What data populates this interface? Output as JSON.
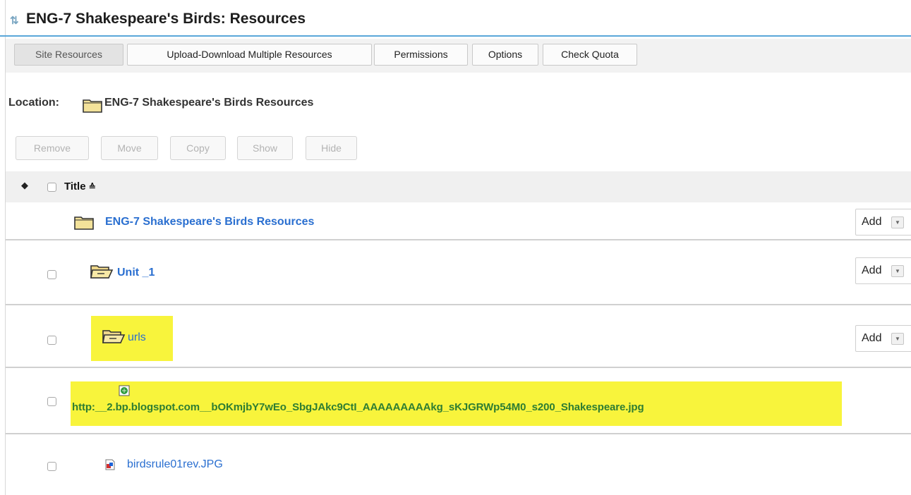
{
  "header": {
    "title": "ENG-7 Shakespeare's Birds: Resources",
    "sync_icon": "sync-arrows-icon"
  },
  "tabs": [
    {
      "label": "Site Resources",
      "active": true
    },
    {
      "label": "Upload-Download Multiple Resources",
      "active": false
    },
    {
      "label": "Permissions",
      "active": false
    },
    {
      "label": "Options",
      "active": false
    },
    {
      "label": "Check Quota",
      "active": false
    }
  ],
  "location": {
    "label": "Location:",
    "path": "ENG-7 Shakespeare's Birds Resources",
    "icon": "folder-icon"
  },
  "actions": [
    "Remove",
    "Move",
    "Copy",
    "Show",
    "Hide"
  ],
  "table": {
    "title_header": "Title"
  },
  "rows": [
    {
      "name": "ENG-7 Shakespeare's Birds Resources",
      "type": "folder",
      "has_checkbox": false,
      "action": "Add"
    },
    {
      "name": "Unit _1",
      "type": "folder-open",
      "has_checkbox": true,
      "action": "Add"
    },
    {
      "name": "urls",
      "type": "folder-open",
      "has_checkbox": true,
      "action": "Add",
      "highlighted": true
    },
    {
      "name": "http:__2.bp.blogspot.com__bOKmjbY7wEo_SbgJAkc9CtI_AAAAAAAAAkg_sKJGRWp54M0_s200_Shakespeare.jpg",
      "type": "web-link",
      "has_checkbox": true,
      "highlighted": true
    },
    {
      "name": "birdsrule01rev.JPG",
      "type": "image-file",
      "has_checkbox": true
    }
  ],
  "colors": {
    "accent": "#5aa7d9",
    "link": "#2a6fd0",
    "highlight": "#f8f43c"
  }
}
